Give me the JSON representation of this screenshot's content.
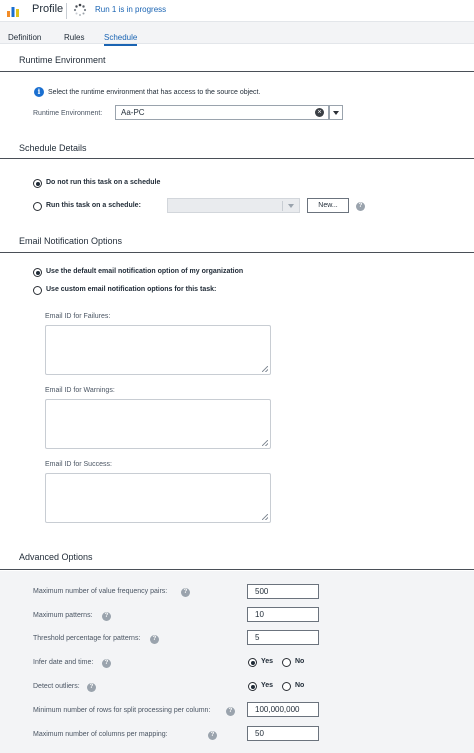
{
  "header": {
    "title": "Profile",
    "run_status": "Run 1 is in progress"
  },
  "tabs": [
    {
      "label": "Definition",
      "active": false
    },
    {
      "label": "Rules",
      "active": false
    },
    {
      "label": "Schedule",
      "active": true
    }
  ],
  "runtime": {
    "section_title": "Runtime Environment",
    "info_text": "Select the runtime environment that has access to the source object.",
    "field_label": "Runtime Environment:",
    "value": "Aa-PC"
  },
  "schedule": {
    "section_title": "Schedule Details",
    "option_none": "Do not run this task on a schedule",
    "option_scheduled": "Run this task on a schedule:",
    "selected": "none",
    "new_button": "New..."
  },
  "email": {
    "section_title": "Email Notification Options",
    "option_default": "Use the default email notification option of my organization",
    "option_custom": "Use custom email notification options for this task:",
    "selected": "default",
    "failures_label": "Email ID for Failures:",
    "warnings_label": "Email ID for Warnings:",
    "success_label": "Email ID for Success:"
  },
  "advanced": {
    "section_title": "Advanced Options",
    "max_value_pairs_label": "Maximum number of value frequency pairs:",
    "max_value_pairs": "500",
    "max_patterns_label": "Maximum patterns:",
    "max_patterns": "10",
    "threshold_label": "Threshold percentage for patterns:",
    "threshold": "5",
    "infer_label": "Infer date and time:",
    "infer_yes": "Yes",
    "infer_no": "No",
    "infer_selected": "yes",
    "outliers_label": "Detect outliers:",
    "outliers_yes": "Yes",
    "outliers_no": "No",
    "outliers_selected": "yes",
    "min_rows_label": "Minimum number of rows for split processing per column:",
    "min_rows": "100,000,000",
    "max_columns_label": "Maximum number of columns per mapping:",
    "max_columns": "50"
  },
  "icons": {
    "app": "bar-chart-icon",
    "spinner": "spinner-icon",
    "info": "info-icon",
    "clear": "clear-icon",
    "help": "help-icon"
  },
  "colors": {
    "accent": "#1a64b3",
    "info_blue": "#1a6fd0",
    "panel_bg": "#f3f4f6"
  }
}
